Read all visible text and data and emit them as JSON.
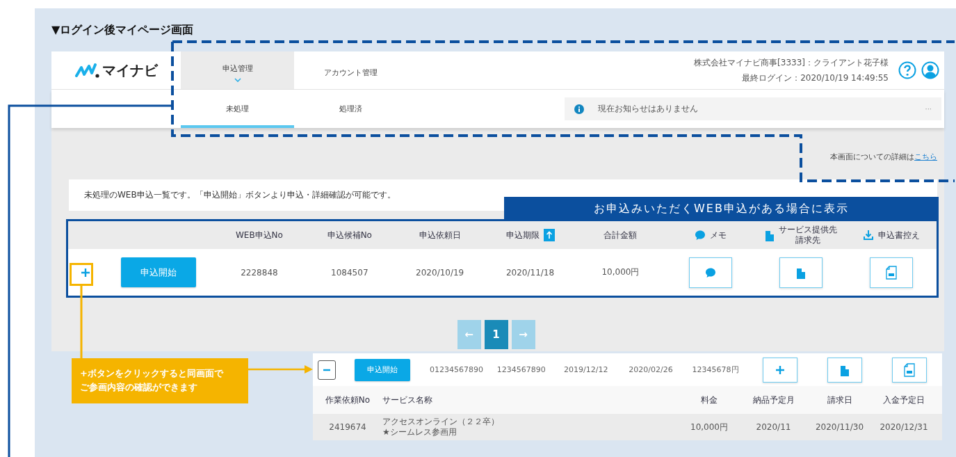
{
  "heading": "▼ログイン後マイページ画面",
  "app": {
    "logo": "マイナビ",
    "nav_tabs": [
      {
        "label": "申込管理",
        "selected": true
      },
      {
        "label": "アカウント管理",
        "selected": false
      }
    ],
    "user": "株式会社マイナビ商事[3333]：クライアント花子様",
    "last_login": "最終ログイン：2020/10/19 14:49:55",
    "sub_tabs": [
      {
        "label": "未処理",
        "selected": true
      },
      {
        "label": "処理済",
        "selected": false
      }
    ],
    "notice": {
      "text": "現在お知らせはありません",
      "more": "···"
    },
    "detail_link": {
      "text": "本画面についての詳細は",
      "link": "こちら"
    },
    "intro": "未処理のWEB申込一覧です。「申込開始」ボタンより申込・詳細確認が可能です。",
    "table": {
      "data_columns": [
        {
          "label": "WEB申込No",
          "sorted": false
        },
        {
          "label": "申込候補No",
          "sorted": false
        },
        {
          "label": "申込依頼日",
          "sorted": false
        },
        {
          "label": "申込期限",
          "sorted": true
        },
        {
          "label": "合計金額",
          "sorted": false
        }
      ],
      "action_columns": [
        {
          "kind": "memo",
          "label": "メモ"
        },
        {
          "kind": "billing",
          "label": [
            "サービス提供先",
            "請求先"
          ]
        },
        {
          "kind": "download",
          "label": "申込書控え"
        }
      ],
      "rows": [
        {
          "expanded": false,
          "action": "申込開始",
          "cells": [
            "2228848",
            "1084507",
            "2020/10/19",
            "2020/11/18",
            "10,000円"
          ],
          "buttons": [
            {
              "kind": "memo"
            },
            {
              "kind": "billing"
            },
            {
              "kind": "pdf"
            }
          ]
        }
      ]
    },
    "pagination": {
      "prev": {
        "label": "←",
        "disabled": true
      },
      "pages": [
        {
          "label": "1",
          "selected": true
        }
      ],
      "next": {
        "label": "→",
        "disabled": true
      }
    }
  },
  "expanded_row": {
    "expanded": true,
    "action": "申込開始",
    "cells": [
      "01234567890",
      "1234567890",
      "2019/12/12",
      "2020/02/26",
      "12345678円"
    ],
    "buttons": [
      {
        "kind": "add"
      },
      {
        "kind": "billing"
      },
      {
        "kind": "pdf"
      }
    ],
    "detail_columns": [
      "作業依頼No",
      "サービス名称",
      "料金",
      "納品予定月",
      "請求日",
      "入金予定日"
    ],
    "detail_rows": [
      {
        "cells": [
          [
            "2419674"
          ],
          [
            "アクセスオンライン（２２卒）",
            "★シームレス参画用"
          ],
          [
            "10,000円"
          ],
          [
            "2020/11"
          ],
          [
            "2020/11/30"
          ],
          [
            "2020/12/31"
          ]
        ]
      }
    ]
  },
  "annotations": {
    "banner": "お申込みいただくWEB申込がある場合に表示",
    "callout": [
      "+ボタンをクリックすると同画面で",
      "ご参画内容の確認ができます"
    ]
  }
}
